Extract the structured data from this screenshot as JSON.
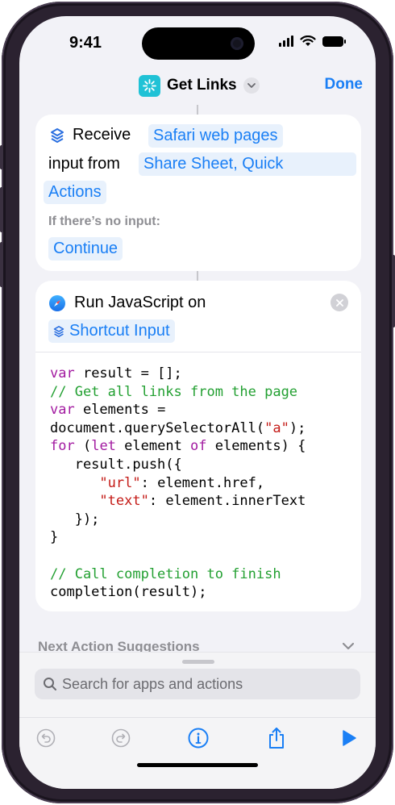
{
  "status_bar": {
    "time": "9:41"
  },
  "navbar": {
    "title": "Get Links",
    "done_label": "Done"
  },
  "receive_action": {
    "receive_label": "Receive",
    "input_type": "Safari web pages",
    "input_from_label": "input from",
    "source_line1": "Share Sheet, Quick",
    "source_line2": "Actions",
    "no_input_label": "If there’s no input:",
    "no_input_value": "Continue"
  },
  "js_action": {
    "title": "Run JavaScript on",
    "variable": "Shortcut Input",
    "code_lines": [
      [
        {
          "t": "var",
          "c": "kw"
        },
        {
          "t": " result = [];"
        }
      ],
      [
        {
          "t": "// Get all links from the page",
          "c": "cm"
        }
      ],
      [
        {
          "t": "var",
          "c": "kw"
        },
        {
          "t": " elements ="
        }
      ],
      [
        {
          "t": "document.querySelectorAll("
        },
        {
          "t": "\"a\"",
          "c": "str"
        },
        {
          "t": ");"
        }
      ],
      [
        {
          "t": "for",
          "c": "kw"
        },
        {
          "t": " ("
        },
        {
          "t": "let",
          "c": "kw"
        },
        {
          "t": " element "
        },
        {
          "t": "of",
          "c": "kw"
        },
        {
          "t": " elements) {"
        }
      ],
      [
        {
          "t": "   result.push({"
        }
      ],
      [
        {
          "t": "      "
        },
        {
          "t": "\"url\"",
          "c": "str"
        },
        {
          "t": ": element.href,"
        }
      ],
      [
        {
          "t": "      "
        },
        {
          "t": "\"text\"",
          "c": "str"
        },
        {
          "t": ": element.innerText"
        }
      ],
      [
        {
          "t": "   });"
        }
      ],
      [
        {
          "t": "}"
        }
      ],
      [
        {
          "t": ""
        }
      ],
      [
        {
          "t": "// Call completion to finish",
          "c": "cm"
        }
      ],
      [
        {
          "t": "completion(result);"
        }
      ]
    ]
  },
  "suggestions": {
    "label": "Next Action Suggestions"
  },
  "search": {
    "placeholder": "Search for apps and actions"
  },
  "toolbar": {
    "icons": [
      "undo-icon",
      "redo-icon",
      "info-icon",
      "share-icon",
      "play-icon"
    ]
  },
  "colors": {
    "accent": "#1a7ff5",
    "app_icon": "#20c2d6",
    "keyword": "#a21aa0",
    "string": "#c41a16",
    "comment": "#23a032"
  }
}
